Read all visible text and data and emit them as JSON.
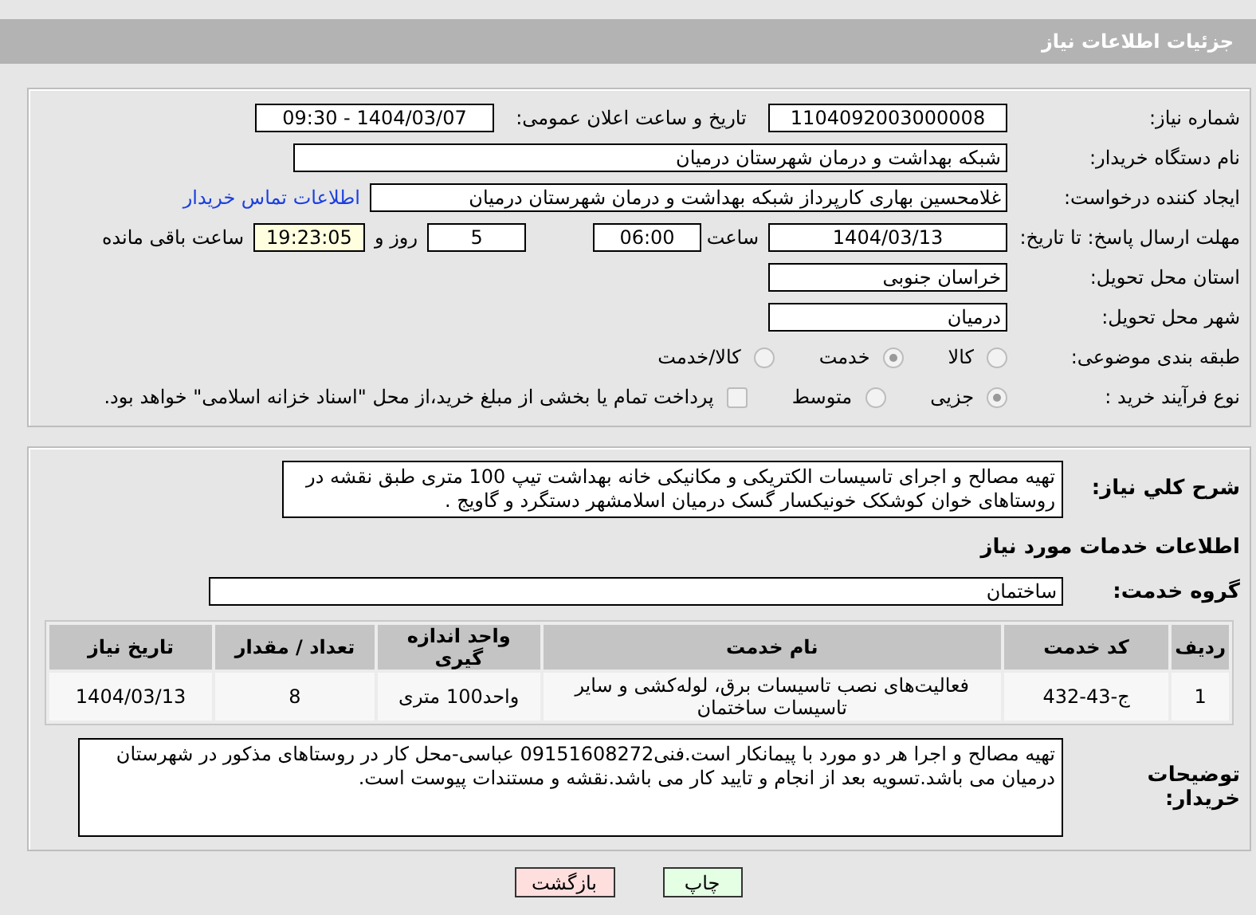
{
  "header": {
    "title": "جزئیات اطلاعات نیاز"
  },
  "need_number": {
    "label": "شماره نیاز:",
    "value": "1104092003000008"
  },
  "announce": {
    "label": "تاریخ و ساعت اعلان عمومی:",
    "value": "1404/03/07 - 09:30"
  },
  "buyer_org": {
    "label": "نام دستگاه خریدار:",
    "value": "شبکه بهداشت و درمان شهرستان درمیان"
  },
  "requester": {
    "label": "ایجاد کننده درخواست:",
    "value": "غلامحسین بهاری کارپرداز شبکه بهداشت و درمان شهرستان درمیان",
    "link": "اطلاعات تماس خریدار"
  },
  "deadline": {
    "label": "مهلت ارسال پاسخ: تا تاریخ:",
    "date": "1404/03/13",
    "time_label": "ساعت",
    "time": "06:00",
    "days": "5",
    "days_label": "روز و",
    "remaining": "19:23:05",
    "remaining_label": "ساعت باقی مانده"
  },
  "province": {
    "label": "استان محل تحویل:",
    "value": "خراسان جنوبی"
  },
  "city": {
    "label": "شهر محل تحویل:",
    "value": "درمیان"
  },
  "category": {
    "label": "طبقه بندی موضوعی:",
    "options": [
      {
        "label": "کالا",
        "selected": false
      },
      {
        "label": "خدمت",
        "selected": true
      },
      {
        "label": "کالا/خدمت",
        "selected": false
      }
    ]
  },
  "process": {
    "label": "نوع فرآیند خرید :",
    "options": [
      {
        "label": "جزیی",
        "selected": true
      },
      {
        "label": "متوسط",
        "selected": false
      }
    ],
    "payment": {
      "checked": false,
      "text": "پرداخت تمام یا بخشی از مبلغ خرید،از محل \"اسناد خزانه اسلامی\" خواهد بود."
    }
  },
  "description": {
    "label": "شرح کلي نياز:",
    "value": "تهیه مصالح و اجرای تاسیسات الکتریکی و مکانیکی خانه بهداشت تیپ 100 متری طبق نقشه در روستاهای خوان کوشکک خونیکسار گسک درمیان اسلامشهر دستگرد و گاویج ."
  },
  "services_title": "اطلاعات خدمات مورد نیاز",
  "service_group": {
    "label": "گروه خدمت:",
    "value": "ساختمان"
  },
  "table": {
    "columns": [
      "ردیف",
      "کد خدمت",
      "نام خدمت",
      "واحد اندازه گیری",
      "تعداد / مقدار",
      "تاریخ نیاز"
    ],
    "rows": [
      [
        "1",
        "ج-43-432",
        "فعالیت‌های نصب تاسیسات برق، لوله‌کشی و سایر تاسیسات ساختمان",
        "واحد100 متری",
        "8",
        "1404/03/13"
      ]
    ]
  },
  "buyer_notes": {
    "label": "توضیحات خریدار:",
    "value": "تهیه مصالح و اجرا هر دو مورد با پیمانکار است.فنی09151608272 عباسی-محل کار در روستاهای مذکور در شهرستان درمیان می باشد.تسویه بعد از انجام و تایید کار می باشد.نقشه و مستندات پیوست است."
  },
  "buttons": [
    {
      "label": "چاپ",
      "kind": "print"
    },
    {
      "label": "بازگشت",
      "kind": "back"
    }
  ]
}
